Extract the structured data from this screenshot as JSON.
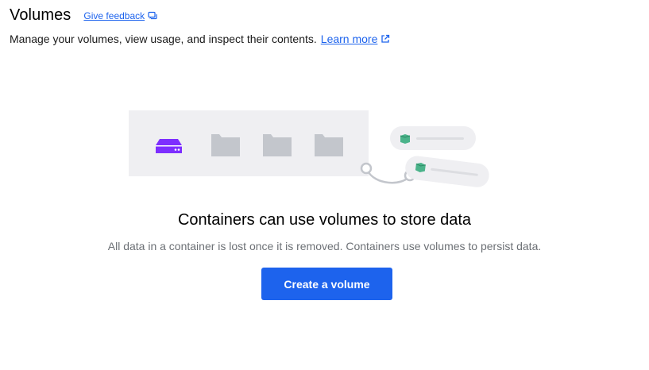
{
  "header": {
    "title": "Volumes",
    "feedback_label": "Give feedback",
    "feedback_icon": "feedback-icon"
  },
  "subtitle": {
    "text": "Manage your volumes, view usage, and inspect their contents.",
    "learn_more": "Learn more",
    "learn_more_icon": "external-link-icon"
  },
  "empty_state": {
    "title": "Containers can use volumes to store data",
    "description": "All data in a container is lost once it is removed. Containers use volumes to persist data.",
    "button_label": "Create a volume"
  },
  "colors": {
    "accent": "#1d63ed",
    "volume_icon": "#7d2eff",
    "folder": "#c3c6cc",
    "panel": "#efeff2",
    "container_icon": "#4bb38a"
  }
}
